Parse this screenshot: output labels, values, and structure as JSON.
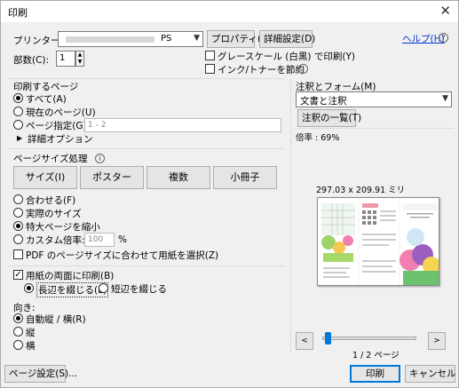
{
  "window": {
    "title": "印刷",
    "close": "✕"
  },
  "printer": {
    "label": "プリンター(N):",
    "value_suffix": "PS",
    "properties_btn": "プロパティ(P)",
    "advanced_btn": "詳細設定(D)",
    "help_link": "ヘルプ(H)",
    "copies_label": "部数(C):",
    "copies_value": "1",
    "grayscale_label": "グレースケール (白黒) で印刷(Y)",
    "ink_save_label": "インク/トナーを節約"
  },
  "pages": {
    "title": "印刷するページ",
    "all": "すべて(A)",
    "current": "現在のページ(U)",
    "specify": "ページ指定(G)",
    "range_placeholder": "1 - 2",
    "more": "詳細オプション"
  },
  "sizing": {
    "title": "ページサイズ処理",
    "tabs": [
      "サイズ(I)",
      "ポスター",
      "複数",
      "小冊子"
    ],
    "fit": "合わせる(F)",
    "actual": "実際のサイズ",
    "shrink": "特大ページを縮小",
    "custom": "カスタム倍率:",
    "custom_value": "100",
    "percent": "%",
    "choose_paper": "PDF のページサイズに合わせて用紙を選択(Z)"
  },
  "duplex": {
    "label": "用紙の両面に印刷(B)",
    "long": "長辺を綴じる(L)",
    "short": "短辺を綴じる"
  },
  "orientation": {
    "title": "向き:",
    "auto": "自動縦 / 横(R)",
    "portrait": "縦",
    "landscape": "横"
  },
  "comments": {
    "title": "注釈とフォーム(M)",
    "value": "文書と注釈",
    "summary_btn": "注釈の一覧(T)"
  },
  "preview": {
    "scale": "倍率 : 69%",
    "dims": "297.03 x 209.91 ミリ",
    "page_info": "1 / 2 ページ",
    "prev": "<",
    "next": ">",
    "slider_level": 0.02
  },
  "footer": {
    "page_setup": "ページ設定(S)...",
    "print": "印刷",
    "cancel": "キャンセル"
  }
}
